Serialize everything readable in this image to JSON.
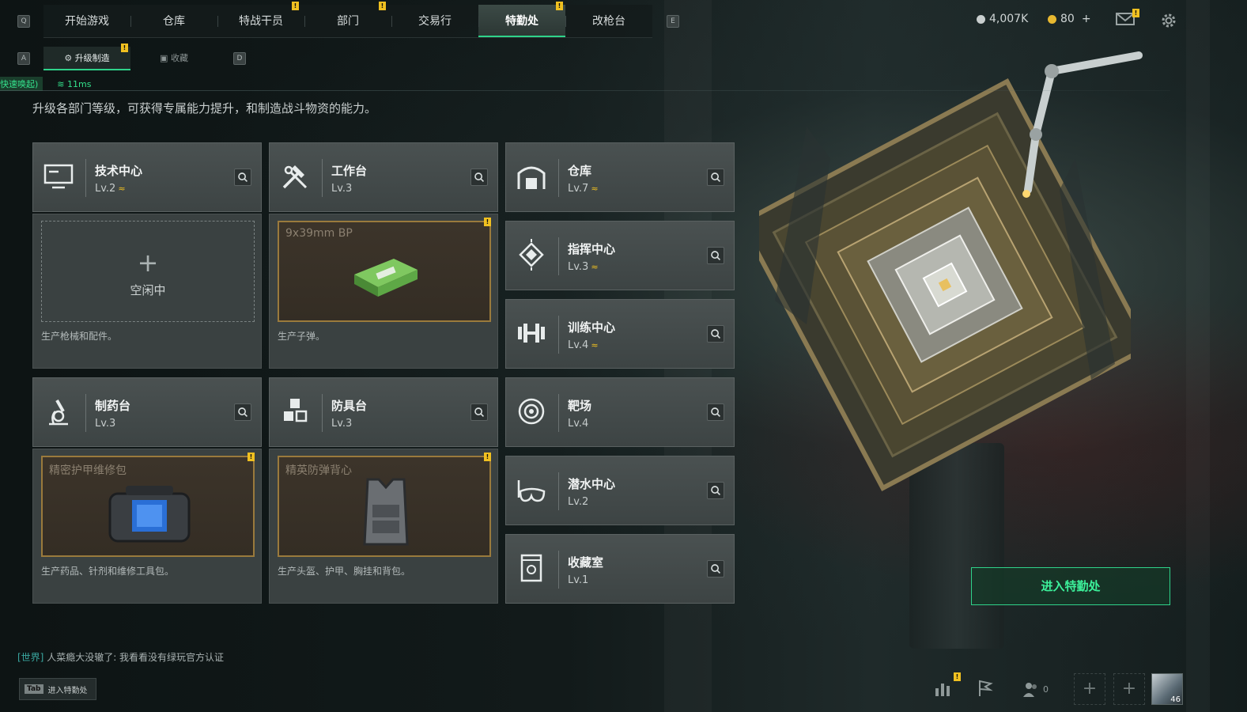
{
  "topbar": {
    "left_key": "Q",
    "right_key": "E",
    "tabs": [
      {
        "label": "开始游戏",
        "badge": ""
      },
      {
        "label": "仓库",
        "badge": ""
      },
      {
        "label": "特战干员",
        "badge": "!"
      },
      {
        "label": "部门",
        "badge": "!"
      },
      {
        "label": "交易行",
        "badge": ""
      },
      {
        "label": "特勤处",
        "badge": "!",
        "active": true
      },
      {
        "label": "改枪台",
        "badge": ""
      }
    ],
    "currency_silver": "4,007K",
    "currency_gold": "80",
    "currency_add": "+",
    "mail_badge": "!"
  },
  "subbar": {
    "left_key": "A",
    "right_key": "D",
    "tabs": [
      {
        "label": "升级制造",
        "badge": "!"
      },
      {
        "label": "收藏",
        "badge": ""
      }
    ],
    "status_tag": "快速唤起)",
    "ping": "11ms"
  },
  "description": "升级各部门等级，可获得专属能力提升，和制造战斗物资的能力。",
  "departments": {
    "tech": {
      "name": "技术中心",
      "level": "Lv.2",
      "upgradable": true,
      "slot_state": "idle",
      "slot_plus": "+",
      "slot_label": "空闲中",
      "desc": "生产枪械和配件。"
    },
    "workbench": {
      "name": "工作台",
      "level": "Lv.3",
      "upgradable": false,
      "slot_item": "9x39mm BP",
      "slot_badge": "!",
      "desc": "生产子弹。"
    },
    "pharmacy": {
      "name": "制药台",
      "level": "Lv.3",
      "upgradable": false,
      "slot_item": "精密护甲维修包",
      "slot_badge": "!",
      "desc": "生产药品、针剂和维修工具包。"
    },
    "armor": {
      "name": "防具台",
      "level": "Lv.3",
      "upgradable": false,
      "slot_item": "精英防弹背心",
      "slot_badge": "!",
      "desc": "生产头盔、护甲、胸挂和背包。"
    },
    "warehouse": {
      "name": "仓库",
      "level": "Lv.7",
      "upgradable": true
    },
    "command": {
      "name": "指挥中心",
      "level": "Lv.3",
      "upgradable": true
    },
    "training": {
      "name": "训练中心",
      "level": "Lv.4",
      "upgradable": true
    },
    "range": {
      "name": "靶场",
      "level": "Lv.4",
      "upgradable": false
    },
    "diving": {
      "name": "潜水中心",
      "level": "Lv.2",
      "upgradable": false
    },
    "collection": {
      "name": "收藏室",
      "level": "Lv.1",
      "upgradable": false
    }
  },
  "upgrade_marker": "≈",
  "enter_button": "进入特勤处",
  "chat": {
    "channel": "[世界]",
    "text": " 人菜瘾大没辙了: 我看看没有绿玩官方认证"
  },
  "tab_hint": {
    "key": "Tab",
    "label": "进入特勤处"
  },
  "bottom": {
    "chart_badge": "!",
    "friends_count": "0",
    "avatar_level": "46"
  },
  "colors": {
    "accent": "#2fd38a",
    "badge": "#f0c020",
    "active_slot_border": "#9a7a3c"
  }
}
